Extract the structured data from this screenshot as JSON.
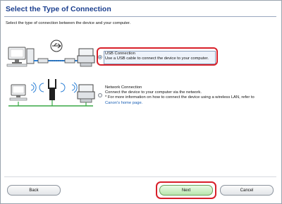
{
  "header": {
    "title": "Select the Type of Connection"
  },
  "instruction": "Select the type of connection between the device and your computer.",
  "options": [
    {
      "title": "USB Connection",
      "description": "Use a USB cable to connect the device to your computer.",
      "selected": true
    },
    {
      "title": "Network Connection",
      "description": "Connect the device to your computer via the network.",
      "note": "* For more information on how to connect the device using a wireless LAN, refer to",
      "link": "Canon's home page."
    }
  ],
  "buttons": {
    "back": "Back",
    "next": "Next",
    "cancel": "Cancel"
  },
  "colors": {
    "title": "#1b3f8f",
    "highlight": "#d8202a",
    "link": "#1a5fb4",
    "next_button": "#b9e6ad"
  }
}
